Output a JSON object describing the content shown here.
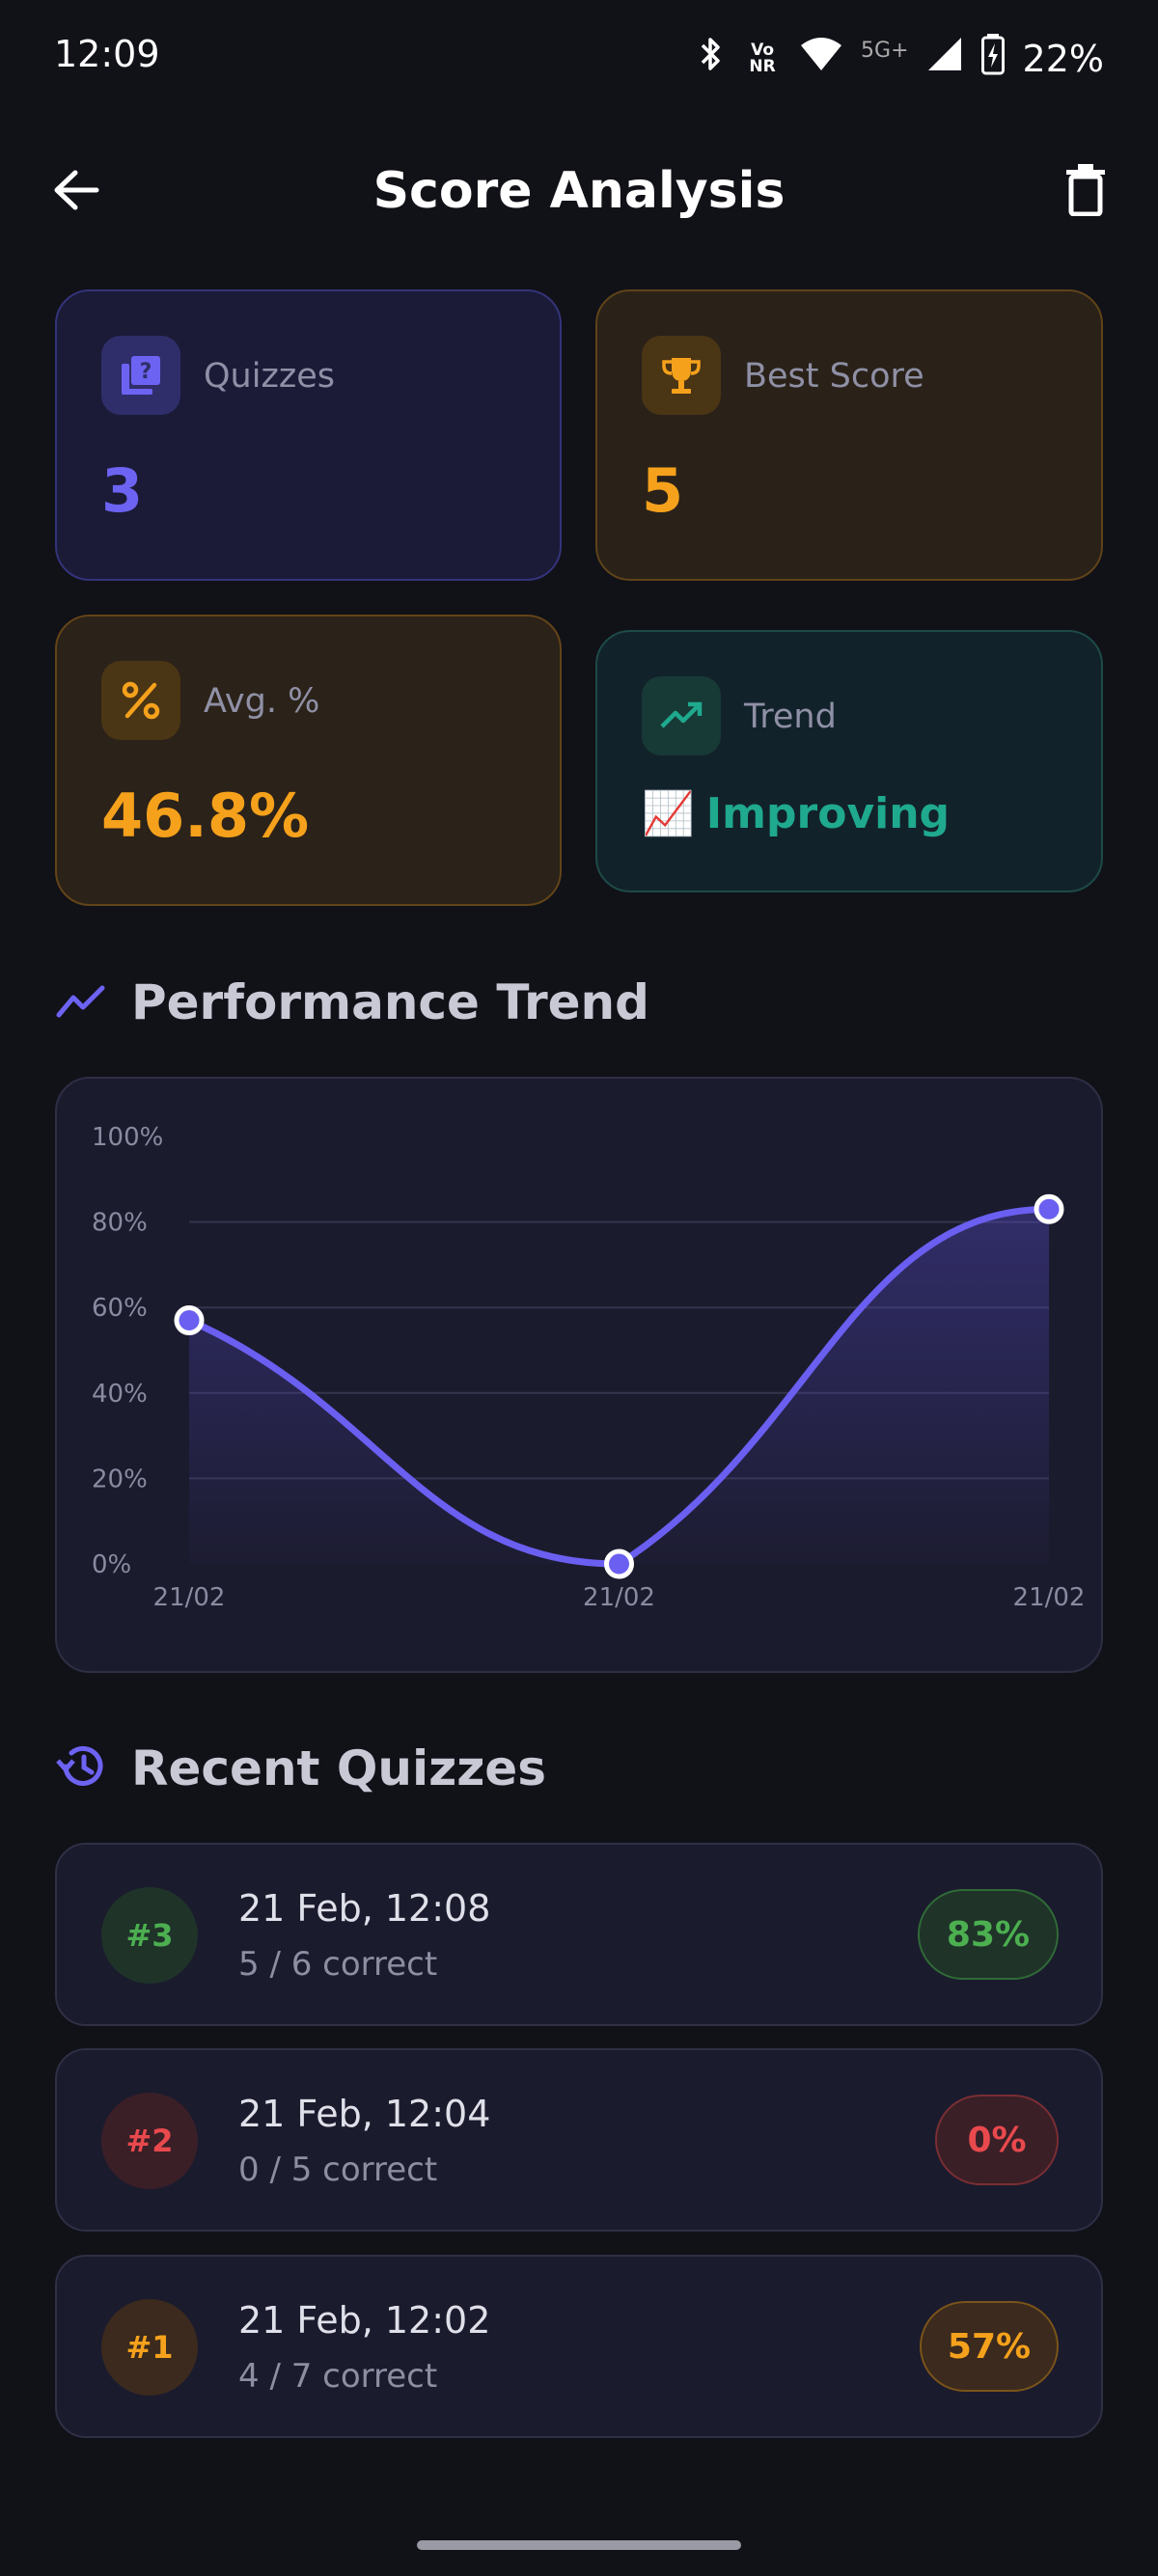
{
  "status_bar": {
    "time": "12:09",
    "network_label": "5G+",
    "volte_label": "Vo NR",
    "battery": "22%"
  },
  "header": {
    "title": "Score Analysis",
    "back_icon": "arrow-left-icon",
    "delete_icon": "trash-icon"
  },
  "stats": {
    "quizzes": {
      "label": "Quizzes",
      "value": "3",
      "icon": "quiz-icon",
      "color": "#6d63f2"
    },
    "best": {
      "label": "Best Score",
      "value": "5",
      "icon": "trophy-icon",
      "color": "#f5a11c"
    },
    "avg": {
      "label": "Avg. %",
      "value": "46.8%",
      "icon": "percent-icon",
      "color": "#f5a11c"
    },
    "trend": {
      "label": "Trend",
      "value": "Improving",
      "emoji": "📈",
      "icon": "trending-up-icon",
      "color": "#1fa98e"
    }
  },
  "performance_section": {
    "title": "Performance Trend",
    "icon": "trend-line-icon"
  },
  "chart_data": {
    "type": "area",
    "x": [
      "21/02",
      "21/02",
      "21/02"
    ],
    "values": [
      57,
      0,
      83
    ],
    "ylim": [
      0,
      100
    ],
    "yticks": [
      "0%",
      "20%",
      "40%",
      "60%",
      "80%",
      "100%"
    ],
    "grid": true,
    "line_color": "#6a5ff0"
  },
  "recent_section": {
    "title": "Recent Quizzes",
    "icon": "history-icon"
  },
  "quizzes": [
    {
      "num": "#3",
      "date": "21 Feb, 12:08",
      "sub": "5 / 6 correct",
      "pct": "83%",
      "color": "#4caf50"
    },
    {
      "num": "#2",
      "date": "21 Feb, 12:04",
      "sub": "0 / 5 correct",
      "pct": "0%",
      "color": "#e9494d"
    },
    {
      "num": "#1",
      "date": "21 Feb, 12:02",
      "sub": "4 / 7 correct",
      "pct": "57%",
      "color": "#f5a11c"
    }
  ]
}
